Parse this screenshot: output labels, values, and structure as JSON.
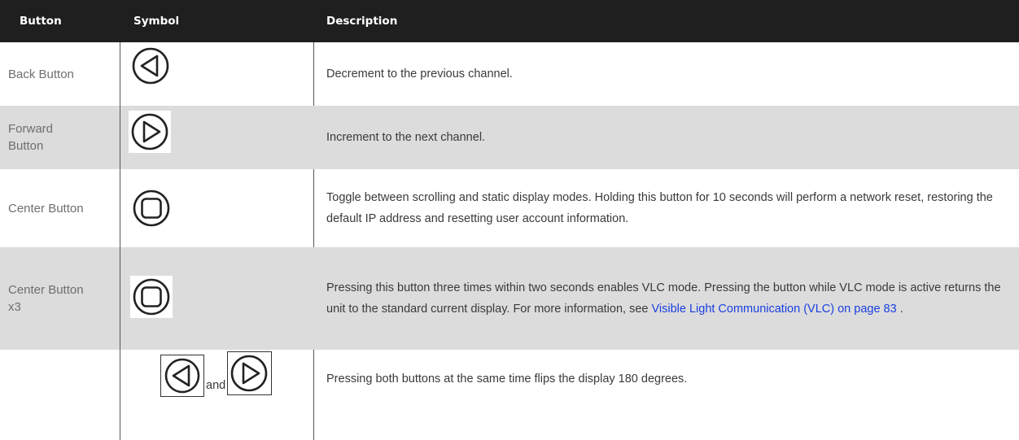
{
  "header": {
    "button": "Button",
    "symbol": "Symbol",
    "description": "Description"
  },
  "rows": [
    {
      "button": "Back Button",
      "symbol_icon": "back-triangle-icon",
      "description": "Decrement to the previous channel."
    },
    {
      "button": "Forward Button",
      "symbol_icon": "forward-triangle-icon",
      "description": "Increment to the next channel."
    },
    {
      "button": "Center Button",
      "symbol_icon": "center-square-icon",
      "description": "Toggle between scrolling and static display modes. Holding this button for 10 seconds will perform a network reset, restoring the default IP address and resetting user account information."
    },
    {
      "button": "Center Button x3",
      "symbol_icon": "center-square-icon",
      "description_before": "Pressing this button three times within two seconds enables VLC mode. Pressing the button while VLC mode is active returns the unit to the standard current display. For more information, see ",
      "link_text": "Visible Light Communication (VLC)",
      "link_page": "on page 83",
      "description_after": " ."
    },
    {
      "button": "",
      "symbol_icons": [
        "back-triangle-icon",
        "forward-triangle-icon"
      ],
      "and_label": "and",
      "description": "Pressing both buttons at the same time flips the display 180 degrees."
    }
  ],
  "colors": {
    "header_bg": "#1f1f1f",
    "shaded_row": "#dcdcdc",
    "link": "#1a3fe0"
  }
}
